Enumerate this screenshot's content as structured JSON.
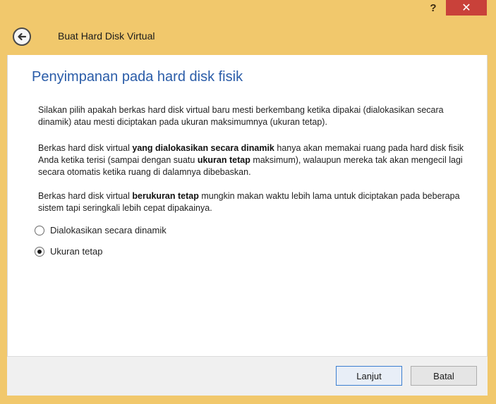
{
  "titlebar": {
    "help_label": "?",
    "close_label": "✕"
  },
  "header": {
    "title": "Buat Hard Disk Virtual"
  },
  "main": {
    "heading": "Penyimpanan pada hard disk fisik",
    "para1": "Silakan pilih apakah berkas hard disk virtual baru mesti berkembang ketika dipakai (dialokasikan secara dinamik) atau mesti diciptakan pada ukuran maksimumnya (ukuran tetap).",
    "para2_a": "Berkas hard disk virtual ",
    "para2_b": "yang dialokasikan secara dinamik",
    "para2_c": " hanya akan memakai ruang pada hard disk fisik Anda ketika terisi (sampai dengan suatu ",
    "para2_d": "ukuran tetap",
    "para2_e": " maksimum), walaupun mereka tak akan mengecil lagi secara otomatis ketika ruang di dalamnya dibebaskan.",
    "para3_a": "Berkas hard disk virtual ",
    "para3_b": "berukuran tetap",
    "para3_c": " mungkin makan waktu lebih lama untuk diciptakan pada beberapa sistem tapi seringkali lebih cepat dipakainya.",
    "options": [
      {
        "label": "Dialokasikan secara dinamik",
        "checked": false
      },
      {
        "label": "Ukuran tetap",
        "checked": true
      }
    ]
  },
  "footer": {
    "next_label": "Lanjut",
    "cancel_label": "Batal"
  },
  "colors": {
    "window_frame": "#f1c86c",
    "heading": "#2a5ca8",
    "close_button": "#c9413a"
  }
}
